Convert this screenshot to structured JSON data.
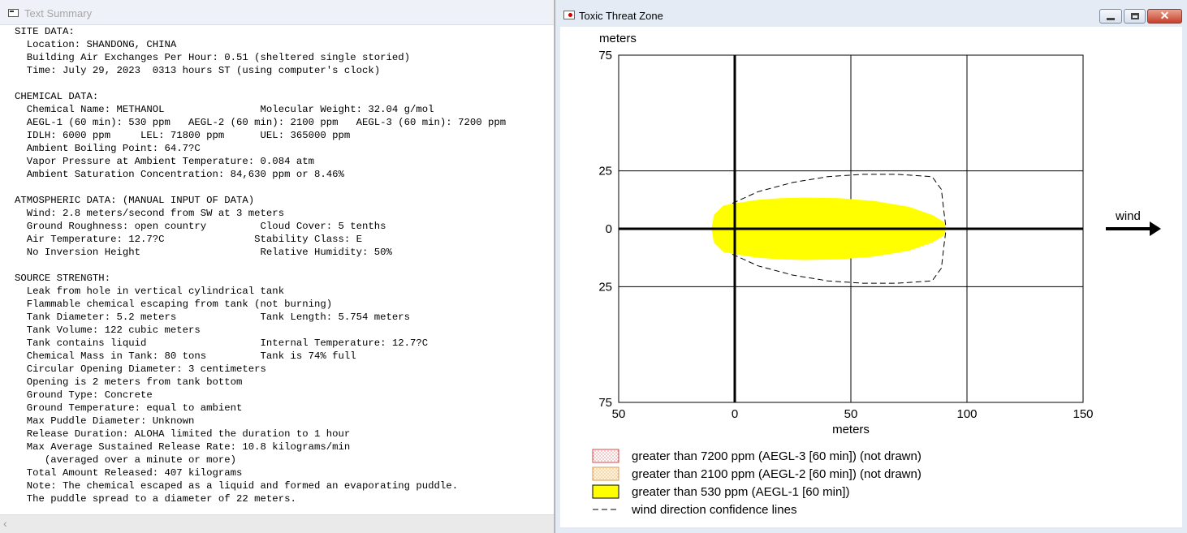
{
  "summary_window": {
    "title": "Text Summary",
    "lines": [
      "SITE DATA:",
      "  Location: SHANDONG, CHINA",
      "  Building Air Exchanges Per Hour: 0.51 (sheltered single storied)",
      "  Time: July 29, 2023  0313 hours ST (using computer's clock)",
      "",
      "CHEMICAL DATA:",
      "  Chemical Name: METHANOL                Molecular Weight: 32.04 g/mol",
      "  AEGL-1 (60 min): 530 ppm   AEGL-2 (60 min): 2100 ppm   AEGL-3 (60 min): 7200 ppm",
      "  IDLH: 6000 ppm     LEL: 71800 ppm      UEL: 365000 ppm",
      "  Ambient Boiling Point: 64.7?C",
      "  Vapor Pressure at Ambient Temperature: 0.084 atm",
      "  Ambient Saturation Concentration: 84,630 ppm or 8.46%",
      "",
      "ATMOSPHERIC DATA: (MANUAL INPUT OF DATA)",
      "  Wind: 2.8 meters/second from SW at 3 meters",
      "  Ground Roughness: open country         Cloud Cover: 5 tenths",
      "  Air Temperature: 12.7?C               Stability Class: E",
      "  No Inversion Height                    Relative Humidity: 50%",
      "",
      "SOURCE STRENGTH:",
      "  Leak from hole in vertical cylindrical tank",
      "  Flammable chemical escaping from tank (not burning)",
      "  Tank Diameter: 5.2 meters              Tank Length: 5.754 meters",
      "  Tank Volume: 122 cubic meters",
      "  Tank contains liquid                   Internal Temperature: 12.7?C",
      "  Chemical Mass in Tank: 80 tons         Tank is 74% full",
      "  Circular Opening Diameter: 3 centimeters",
      "  Opening is 2 meters from tank bottom",
      "  Ground Type: Concrete",
      "  Ground Temperature: equal to ambient",
      "  Max Puddle Diameter: Unknown",
      "  Release Duration: ALOHA limited the duration to 1 hour",
      "  Max Average Sustained Release Rate: 10.8 kilograms/min",
      "     (averaged over a minute or more)",
      "  Total Amount Released: 407 kilograms",
      "  Note: The chemical escaped as a liquid and formed an evaporating puddle.",
      "  The puddle spread to a diameter of 22 meters."
    ],
    "scroll_left_glyph": "‹"
  },
  "threat_window": {
    "title": "Toxic Threat Zone",
    "buttons": {
      "min": "",
      "max": "",
      "close": "✕"
    },
    "colors": {
      "aegl3": "#e06060",
      "aegl2": "#f0c89a",
      "aegl1": "#ffff00"
    }
  },
  "chart_data": {
    "type": "area",
    "ylabel": "meters",
    "xlabel": "meters",
    "x_ticks": [
      "50",
      "0",
      "50",
      "100",
      "150"
    ],
    "y_ticks": [
      "75",
      "25",
      "0",
      "25",
      "75"
    ],
    "x_range": [
      -50,
      150
    ],
    "y_range": [
      -75,
      75
    ],
    "grid": true,
    "wind_label": "wind",
    "wind_direction": "east",
    "threat_zone": {
      "name": "greater than 530 ppm (AEGL-1 [60 min])",
      "color": "#ffff00",
      "x_start": -10,
      "x_end": 91,
      "max_half_width": 13.5,
      "outline": [
        [
          -10,
          0
        ],
        [
          -9,
          6
        ],
        [
          -5,
          10
        ],
        [
          0,
          11
        ],
        [
          10,
          12.5
        ],
        [
          20,
          13.2
        ],
        [
          30,
          13.5
        ],
        [
          45,
          13.2
        ],
        [
          60,
          12
        ],
        [
          75,
          9.5
        ],
        [
          85,
          6
        ],
        [
          90,
          3
        ],
        [
          91,
          0
        ],
        [
          90,
          -3
        ],
        [
          85,
          -6
        ],
        [
          75,
          -9.5
        ],
        [
          60,
          -12
        ],
        [
          45,
          -13.2
        ],
        [
          30,
          -13.5
        ],
        [
          20,
          -13.2
        ],
        [
          10,
          -12.5
        ],
        [
          0,
          -11
        ],
        [
          -5,
          -10
        ],
        [
          -9,
          -6
        ],
        [
          -10,
          0
        ]
      ]
    },
    "confidence_lines": {
      "upper": [
        [
          -1,
          11
        ],
        [
          10,
          16
        ],
        [
          25,
          20
        ],
        [
          40,
          22.5
        ],
        [
          55,
          23.5
        ],
        [
          70,
          23.5
        ],
        [
          85,
          22.5
        ],
        [
          89,
          17
        ],
        [
          90,
          8
        ],
        [
          91,
          0
        ]
      ],
      "lower": [
        [
          -1,
          -11
        ],
        [
          10,
          -16
        ],
        [
          25,
          -20
        ],
        [
          40,
          -22.5
        ],
        [
          55,
          -23.5
        ],
        [
          70,
          -23.5
        ],
        [
          85,
          -22.5
        ],
        [
          89,
          -17
        ],
        [
          90,
          -8
        ],
        [
          91,
          0
        ]
      ]
    },
    "legend": [
      {
        "label": "greater than 7200 ppm (AEGL-3 [60 min]) (not drawn)",
        "style": "dotted-red"
      },
      {
        "label": "greater than 2100 ppm (AEGL-2 [60 min]) (not drawn)",
        "style": "dotted-orange"
      },
      {
        "label": "greater than 530 ppm (AEGL-1 [60 min])",
        "style": "solid-yellow"
      },
      {
        "label": "wind direction confidence lines",
        "style": "dashed"
      }
    ]
  }
}
